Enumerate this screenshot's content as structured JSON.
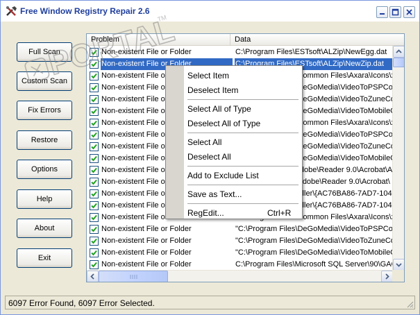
{
  "window": {
    "title": "Free Window Registry Repair 2.6"
  },
  "watermark": {
    "text": "PORTAL",
    "mark": "TM"
  },
  "sidebar": {
    "buttons": [
      {
        "label": "Full Scan"
      },
      {
        "label": "Custom Scan"
      },
      {
        "label": "Fix Errors"
      },
      {
        "label": "Restore"
      },
      {
        "label": "Options"
      },
      {
        "label": "Help"
      },
      {
        "label": "About"
      },
      {
        "label": "Exit"
      }
    ]
  },
  "list": {
    "columns": [
      "Problem",
      "Data"
    ],
    "rows": [
      {
        "problem": "Non-existent File or Folder",
        "data": "C:\\Program Files\\ESTsoft\\ALZip\\NewEgg.dat",
        "checked": true,
        "selected": false
      },
      {
        "problem": "Non-existent File or Folder",
        "data": "C:\\Program Files\\ESTsoft\\ALZip\\NewZip.dat",
        "checked": true,
        "selected": true
      },
      {
        "problem": "Non-existent File or Folder",
        "data": "\"C:\\Program Files\\Common Files\\Axara\\Icons\\x",
        "checked": true,
        "selected": false
      },
      {
        "problem": "Non-existent File or Folder",
        "data": "\"C:\\Program Files\\DeGoMedia\\VideoToPSPCon",
        "checked": true,
        "selected": false
      },
      {
        "problem": "Non-existent File or Folder",
        "data": "\"C:\\Program Files\\DeGoMedia\\VideoToZuneCo",
        "checked": true,
        "selected": false
      },
      {
        "problem": "Non-existent File or Folder",
        "data": "\"C:\\Program Files\\DeGoMedia\\VideoToMobileC",
        "checked": true,
        "selected": false
      },
      {
        "problem": "Non-existent File or Folder",
        "data": "\"C:\\Program Files\\Common Files\\Axara\\Icons\\x",
        "checked": true,
        "selected": false
      },
      {
        "problem": "Non-existent File or Folder",
        "data": "\"C:\\Program Files\\DeGoMedia\\VideoToPSPCon",
        "checked": true,
        "selected": false
      },
      {
        "problem": "Non-existent File or Folder",
        "data": "\"C:\\Program Files\\DeGoMedia\\VideoToZuneCo",
        "checked": true,
        "selected": false
      },
      {
        "problem": "Non-existent File or Folder",
        "data": "\"C:\\Program Files\\DeGoMedia\\VideoToMobileC",
        "checked": true,
        "selected": false
      },
      {
        "problem": "Non-existent File or Folder",
        "data": "C:\\Program Files\\Adobe\\Reader 9.0\\Acrobat\\A",
        "checked": true,
        "selected": false
      },
      {
        "problem": "Non-existent File or Folder",
        "data": "\"C:\\Program Files\\Adobe\\Reader 9.0\\Acrobat\\",
        "checked": true,
        "selected": false
      },
      {
        "problem": "Non-existent File or Folder",
        "data": "C:\\WINDOWS\\Installer\\{AC76BA86-7AD7-1049-7",
        "checked": true,
        "selected": false
      },
      {
        "problem": "Non-existent File or Folder",
        "data": "C:\\WINDOWS\\Installer\\{AC76BA86-7AD7-1049-7",
        "checked": true,
        "selected": false
      },
      {
        "problem": "Non-existent File or Folder",
        "data": "\"C:\\Program Files\\Common Files\\Axara\\Icons\\x",
        "checked": true,
        "selected": false
      },
      {
        "problem": "Non-existent File or Folder",
        "data": "\"C:\\Program Files\\DeGoMedia\\VideoToPSPCon",
        "checked": true,
        "selected": false
      },
      {
        "problem": "Non-existent File or Folder",
        "data": "\"C:\\Program Files\\DeGoMedia\\VideoToZuneCo",
        "checked": true,
        "selected": false
      },
      {
        "problem": "Non-existent File or Folder",
        "data": "\"C:\\Program Files\\DeGoMedia\\VideoToMobileC",
        "checked": true,
        "selected": false
      },
      {
        "problem": "Non-existent File or Folder",
        "data": "C:\\Program Files\\Microsoft SQL Server\\90\\GAC",
        "checked": true,
        "selected": false
      }
    ]
  },
  "context_menu": {
    "groups": [
      [
        {
          "label": "Select Item",
          "shortcut": ""
        },
        {
          "label": "Deselect Item",
          "shortcut": ""
        }
      ],
      [
        {
          "label": "Select All of Type",
          "shortcut": ""
        },
        {
          "label": "Deselect All of Type",
          "shortcut": ""
        }
      ],
      [
        {
          "label": "Select All",
          "shortcut": ""
        },
        {
          "label": "Deselect All",
          "shortcut": ""
        }
      ],
      [
        {
          "label": "Add to Exclude List",
          "shortcut": ""
        }
      ],
      [
        {
          "label": "Save as Text...",
          "shortcut": ""
        }
      ],
      [
        {
          "label": "RegEdit...",
          "shortcut": "Ctrl+R"
        }
      ]
    ]
  },
  "status": {
    "text": "6097 Error Found,  6097 Error Selected."
  },
  "colors": {
    "title_text": "#1F3E9E",
    "selection": "#316AC5",
    "window_face": "#ECE9D8"
  }
}
